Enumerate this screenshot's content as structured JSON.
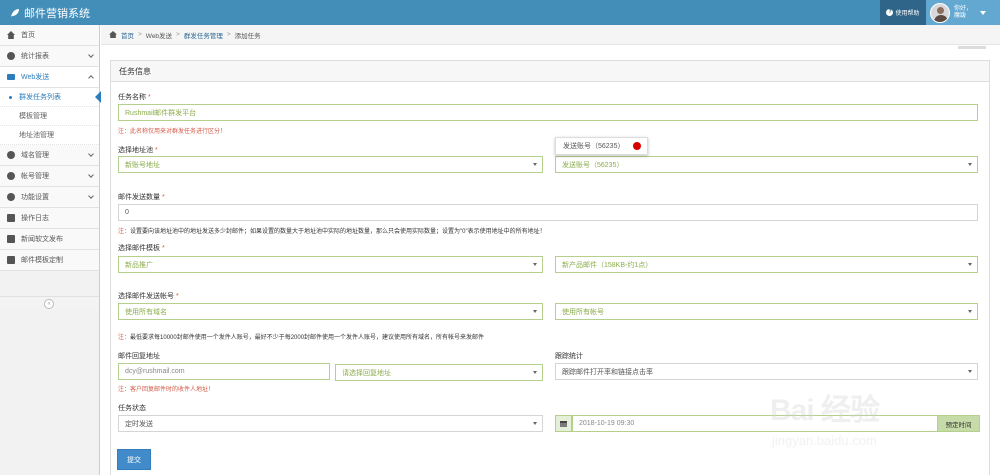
{
  "app": {
    "title": "邮件营销系统"
  },
  "topbar": {
    "help_label": "使用帮助",
    "user_greeting": "你好，",
    "user_name": "魔跋"
  },
  "sidebar": {
    "items": [
      {
        "label": "首页",
        "icon": "home-icon"
      },
      {
        "label": "统计报表",
        "icon": "pie-chart-icon"
      },
      {
        "label": "Web发送",
        "icon": "envelope-icon",
        "active": true
      },
      {
        "label": "域名管理",
        "icon": "globe-icon"
      },
      {
        "label": "帐号管理",
        "icon": "users-icon"
      },
      {
        "label": "功能设置",
        "icon": "cogs-icon"
      },
      {
        "label": "操作日志",
        "icon": "list-icon"
      },
      {
        "label": "新闻软文发布",
        "icon": "newspaper-icon"
      },
      {
        "label": "邮件模板定制",
        "icon": "template-icon"
      }
    ],
    "sub_items": [
      {
        "label": "群发任务列表",
        "active": true
      },
      {
        "label": "模板管理"
      },
      {
        "label": "地址池管理"
      }
    ],
    "collapse_glyph": "«"
  },
  "breadcrumb": {
    "home": "首页",
    "web_send": "Web发送",
    "task_mgmt": "群发任务管理",
    "current": "添加任务"
  },
  "panel": {
    "title": "任务信息"
  },
  "form": {
    "task_name_label": "任务名称",
    "task_name_value": "Rushmail邮件群发平台",
    "task_name_note": "此名称仅用来对群发任务进行区分！",
    "pool_label": "选择地址池",
    "pool_value": "新账号地址",
    "sender_select_value": "发送账号（56235）",
    "tooltip_text": "发送账号（56235）",
    "count_label": "邮件发送数量",
    "count_value": "0",
    "count_note": "设置要向该地址池中的地址发送多少封邮件；如果设置的数量大于地址池中实际的地址数量，那么只会使用实际数量；设置为\"0\"表示使用地址中的所有地址！",
    "template_label": "选择邮件模板",
    "template_value": "新品推广",
    "template_mail_value": "新产品邮件（158KB-约1点）",
    "sender_label": "选择邮件发送帐号",
    "domain_value": "使用所有域名",
    "account_value": "使用所有帐号",
    "sender_note": "最低要求每10000封邮件使用一个发件人账号，最好不少于每2000封邮件使用一个发件人账号，建议使用所有域名，所有帐号来发邮件",
    "reply_label": "邮件回复地址",
    "reply_value": "dcy@rushmail.com",
    "reply_select_value": "请选择回复地址",
    "reply_note": "客户回复邮件时的收件人地址！",
    "track_label": "跟踪统计",
    "track_value": "跟踪邮件打开率和链接点击率",
    "status_label": "任务状态",
    "status_value": "定时发送",
    "datetime_value": "2018-10-19 09:30",
    "schedule_label": "预定时间",
    "note_prefix": "注：",
    "req_mark": "*",
    "submit_label": "提交"
  },
  "watermark": {
    "big": "Bai  经验",
    "url": "jingyan.baidu.com"
  },
  "colors": {
    "topbar": "#438eb9",
    "accent": "#2b7dbc",
    "field_border": "#b5cf8d",
    "required": "#d15b47",
    "submit": "#428bca",
    "status_dot": "#d60000"
  }
}
